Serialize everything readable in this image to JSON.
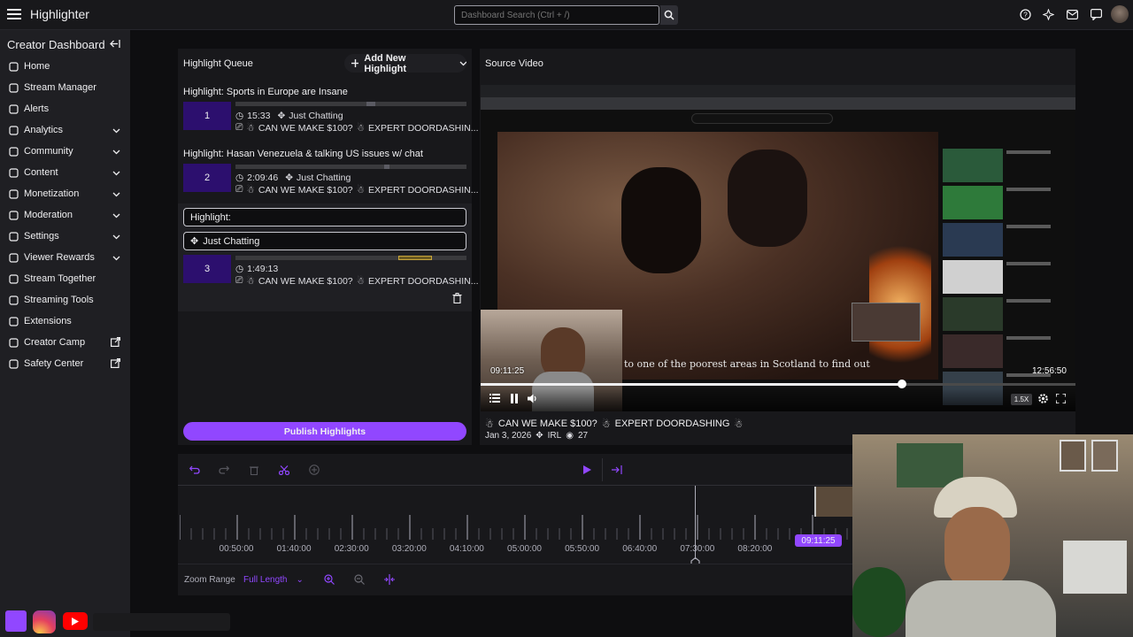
{
  "app": {
    "title": "Highlighter"
  },
  "search": {
    "placeholder": "Dashboard Search (Ctrl + /)"
  },
  "sidebar": {
    "title": "Creator Dashboard",
    "items": [
      {
        "label": "Home",
        "icon": "home-icon",
        "chevron": false,
        "external": false
      },
      {
        "label": "Stream Manager",
        "icon": "stream-manager-icon",
        "chevron": false,
        "external": false
      },
      {
        "label": "Alerts",
        "icon": "alerts-icon",
        "chevron": false,
        "external": false
      },
      {
        "label": "Analytics",
        "icon": "analytics-icon",
        "chevron": true,
        "external": false
      },
      {
        "label": "Community",
        "icon": "community-icon",
        "chevron": true,
        "external": false
      },
      {
        "label": "Content",
        "icon": "content-icon",
        "chevron": true,
        "external": false
      },
      {
        "label": "Monetization",
        "icon": "monetization-icon",
        "chevron": true,
        "external": false
      },
      {
        "label": "Moderation",
        "icon": "moderation-icon",
        "chevron": true,
        "external": false
      },
      {
        "label": "Settings",
        "icon": "settings-icon",
        "chevron": true,
        "external": false
      },
      {
        "label": "Viewer Rewards",
        "icon": "rewards-icon",
        "chevron": true,
        "external": false
      },
      {
        "label": "Stream Together",
        "icon": "stream-together-icon",
        "chevron": false,
        "external": false
      },
      {
        "label": "Streaming Tools",
        "icon": "streaming-tools-icon",
        "chevron": false,
        "external": false
      },
      {
        "label": "Extensions",
        "icon": "extensions-icon",
        "chevron": false,
        "external": false
      },
      {
        "label": "Creator Camp",
        "icon": "creator-camp-icon",
        "chevron": false,
        "external": true
      },
      {
        "label": "Safety Center",
        "icon": "safety-center-icon",
        "chevron": false,
        "external": true
      }
    ]
  },
  "queue": {
    "title": "Highlight Queue",
    "add_label": "Add New Highlight",
    "highlights": [
      {
        "title": "Highlight: Sports in Europe are Insane",
        "number": "1",
        "duration": "15:33",
        "category": "Just Chatting",
        "stream": "CAN WE MAKE $100?",
        "stream2": "EXPERT DOORDASHIN..."
      },
      {
        "title": "Highlight: Hasan Venezuela & talking US issues w/ chat",
        "number": "2",
        "duration": "2:09:46",
        "category": "Just Chatting",
        "stream": "CAN WE MAKE $100?",
        "stream2": "EXPERT DOORDASHIN..."
      }
    ],
    "editing": {
      "title_label": "Highlight:",
      "category": "Just Chatting",
      "number": "3",
      "duration": "1:49:13",
      "stream": "CAN WE MAKE $100?",
      "stream2": "EXPERT DOORDASHIN..."
    },
    "publish_label": "Publish Highlights"
  },
  "source": {
    "title": "Source Video",
    "video_title": "CAN WE MAKE $100?",
    "video_title2": "EXPERT DOORDASHING",
    "date": "Jan 3, 2026",
    "category": "IRL",
    "viewers": "27",
    "current_time": "09:11:25",
    "total_time": "12:56:50",
    "caption": "to one of the poorest areas in Scotland to find out",
    "speed": "1.5X",
    "progress": 0.708
  },
  "timeline": {
    "ticks": [
      "00:50:00",
      "01:40:00",
      "02:30:00",
      "03:20:00",
      "04:10:00",
      "05:00:00",
      "05:50:00",
      "06:40:00",
      "07:30:00",
      "08:20:00"
    ],
    "playhead": "09:11:25",
    "zoom_label": "Zoom Range",
    "zoom_value": "Full Length"
  },
  "colors": {
    "accent": "#9147ff",
    "queue_number": "#2c0f6e",
    "background": "#0e0e10",
    "panel": "#18181b"
  }
}
